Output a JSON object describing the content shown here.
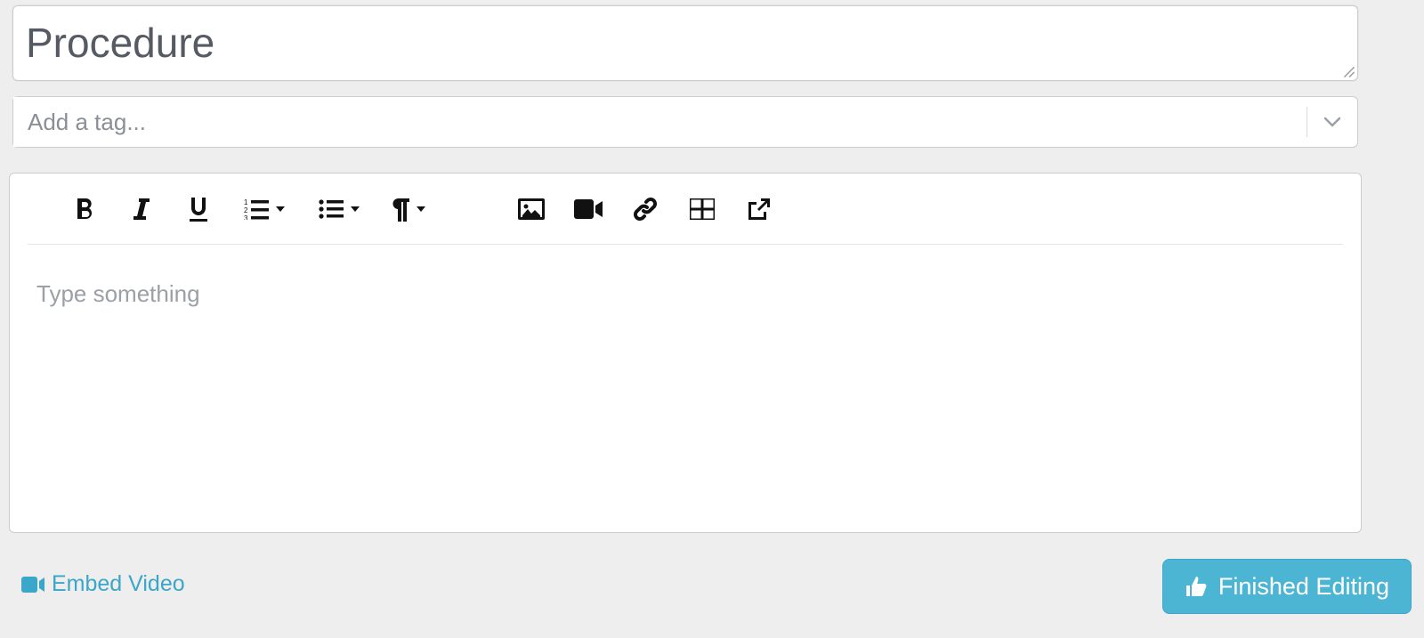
{
  "title": {
    "value": "Procedure"
  },
  "tags": {
    "placeholder": "Add a tag..."
  },
  "editor": {
    "placeholder": "Type something"
  },
  "footer": {
    "embed_label": "Embed Video",
    "finished_label": "Finished Editing"
  },
  "toolbar": {
    "bold": "Bold",
    "italic": "Italic",
    "underline": "Underline",
    "ordered_list": "Ordered list",
    "unordered_list": "Unordered list",
    "paragraph": "Paragraph format",
    "image": "Insert image",
    "video": "Insert video",
    "link": "Insert link",
    "table": "Insert table",
    "external": "Open / fullscreen"
  }
}
